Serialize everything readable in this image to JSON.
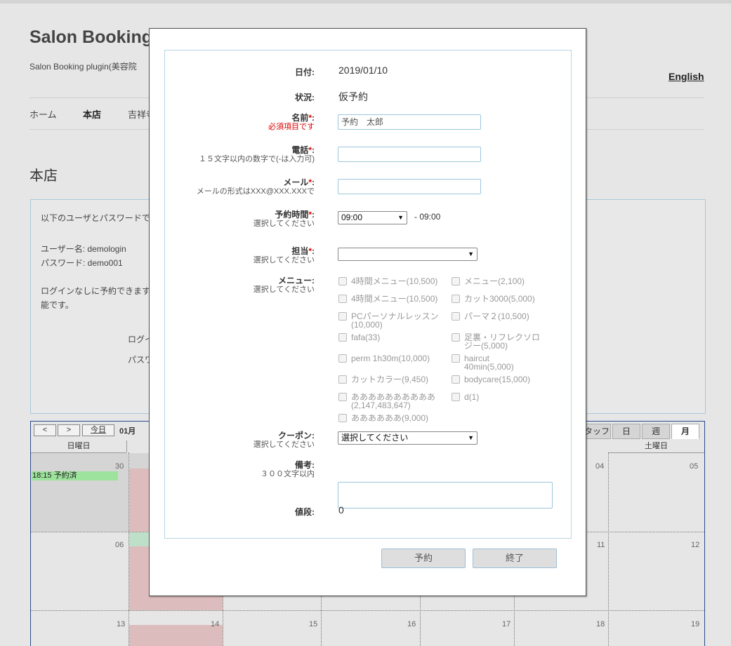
{
  "site": {
    "title": "Salon Booking",
    "description": "Salon Booking plugin(美容院",
    "lang_link": "English"
  },
  "nav": {
    "items": [
      "ホーム",
      "本店",
      "吉祥寺"
    ]
  },
  "store_title": "本店",
  "notice": {
    "line1": "以下のユーザとパスワードで",
    "username": "ユーザー名: demologin",
    "password": "パスワード: demo001",
    "line4": "ログインなしに予約できます",
    "line5": "能です。",
    "login_label": "ログイ",
    "pass_label": "パスワ"
  },
  "calendar": {
    "prev": "<",
    "next": ">",
    "today": "今日",
    "month": "01月",
    "tabs": [
      "タッフ",
      "日",
      "週",
      "月"
    ],
    "active_tab": "月",
    "sunday": "日曜日",
    "saturday": "土曜日",
    "day_numbers": {
      "w1_sun": "30",
      "w1_thu": "04",
      "w1_sat": "05",
      "w2_sun": "06",
      "w2_thu": "11",
      "w2_sat": "12",
      "w3_sun": "13",
      "w3_mon": "14",
      "w3_tue": "15",
      "w3_wed": "16",
      "w3_thu": "17",
      "w3_fri": "18",
      "w3_sat": "19"
    },
    "event": "18:15 予約済"
  },
  "dialog": {
    "date_label": "日付:",
    "date_value": "2019/01/10",
    "status_label": "状況:",
    "status_value": "仮予約",
    "name_label": "名前",
    "name_error": "必須項目です",
    "name_value": "予約　太郎",
    "phone_label": "電話",
    "phone_hint": "１５文字以内の数字で(-は入力可)",
    "mail_label": "メール",
    "mail_hint": "メールの形式はXXX@XXX.XXXで",
    "time_label": "予約時間",
    "time_hint": "選択してください",
    "time_value": "09:00",
    "time_end": "- 09:00",
    "staff_label": "担当",
    "staff_hint": "選択してください",
    "staff_value": "",
    "menu_label": "メニュー:",
    "menu_hint": "選択してください",
    "menu_left": [
      {
        "l1": "4時間メニュー(10,500)",
        "l2": ""
      },
      {
        "l1": "4時間メニュー(10,500)",
        "l2": ""
      },
      {
        "l1": "PCパーソナルレッスン",
        "l2": "(10,000)"
      },
      {
        "l1": "fafa(33)",
        "l2": ""
      },
      {
        "l1": "perm 1h30m(10,000)",
        "l2": ""
      },
      {
        "l1": "カットカラー(9,450)",
        "l2": ""
      },
      {
        "l1": "ああああああああああ",
        "l2": "(2,147,483,647)"
      },
      {
        "l1": "ああああああ(9,000)",
        "l2": ""
      }
    ],
    "menu_right": [
      {
        "l1": "メニュー(2,100)",
        "l2": ""
      },
      {
        "l1": "カット3000(5,000)",
        "l2": ""
      },
      {
        "l1": "パーマ２(10,500)",
        "l2": ""
      },
      {
        "l1": "足裏・リフレクソロ",
        "l2": "ジー(5,000)"
      },
      {
        "l1": "haircut",
        "l2": "40min(5,000)"
      },
      {
        "l1": "bodycare(15,000)",
        "l2": ""
      },
      {
        "l1": "d(1)",
        "l2": ""
      }
    ],
    "coupon_label": "クーポン:",
    "coupon_hint": "選択してください",
    "coupon_value": "選択してください",
    "note_label": "備考:",
    "note_hint": "３００文字以内",
    "price_label": "値段:",
    "price_value": "0",
    "reserve_button": "予約",
    "close_button": "終了"
  }
}
